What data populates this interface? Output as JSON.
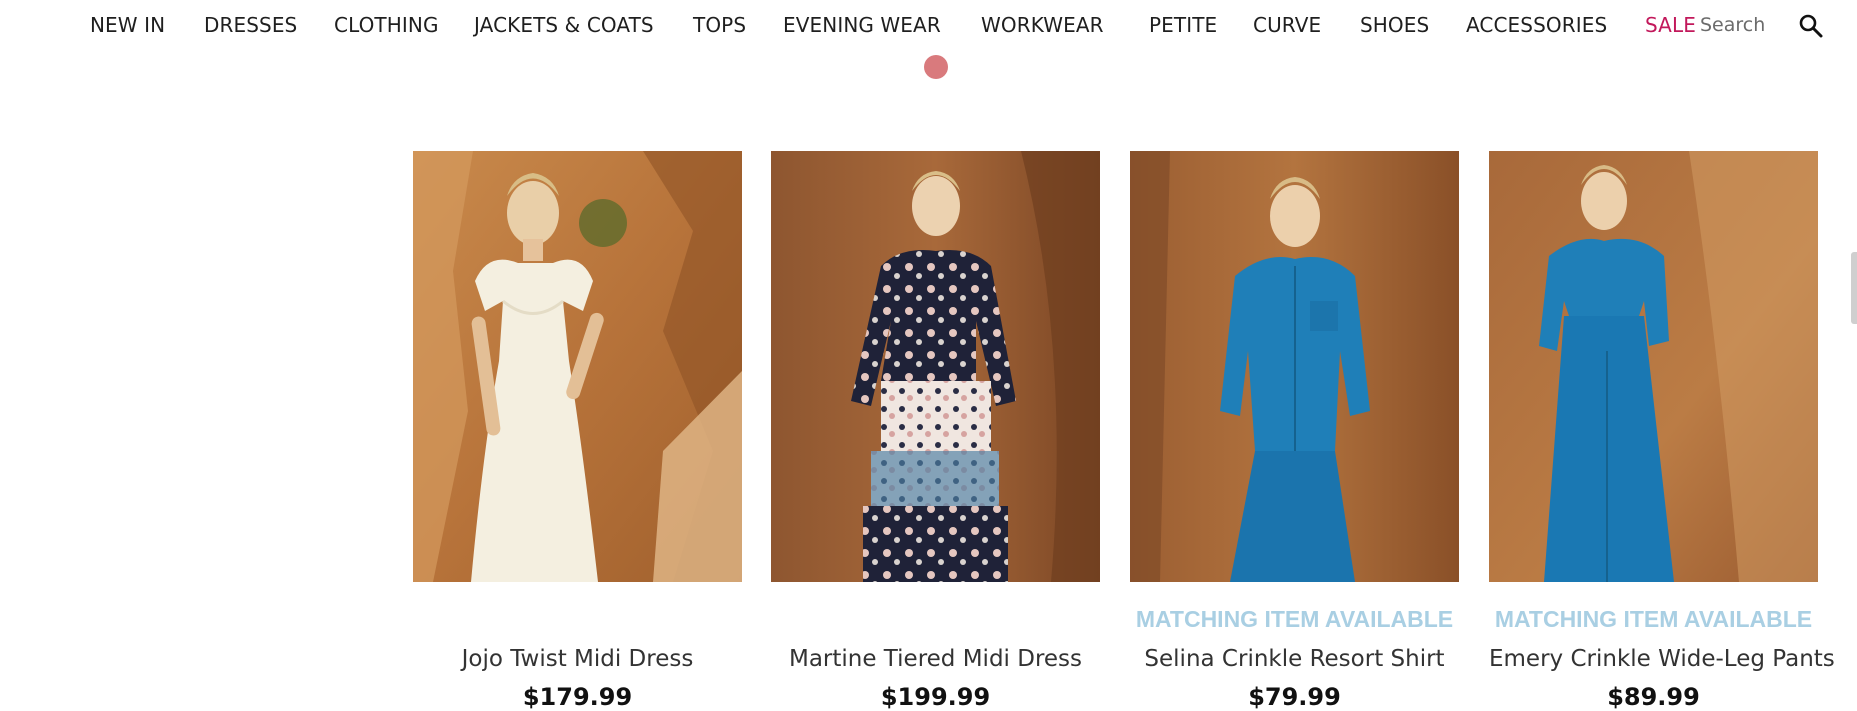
{
  "nav": {
    "items": [
      "NEW IN",
      "DRESSES",
      "CLOTHING",
      "JACKETS & COATS",
      "TOPS",
      "EVENING WEAR",
      "WORKWEAR",
      "PETITE",
      "CURVE",
      "SHOES",
      "ACCESSORIES"
    ],
    "sale": "SALE",
    "search_placeholder": "Search"
  },
  "products": [
    {
      "name": "Jojo Twist Midi Dress",
      "badge": "",
      "price": "$179.99"
    },
    {
      "name": "Martine Tiered Midi Dress",
      "badge": "",
      "price": "$199.99"
    },
    {
      "name": "Selina Crinkle Resort Shirt",
      "badge": "MATCHING ITEM AVAILABLE",
      "price": "$79.99"
    },
    {
      "name": "Emery Crinkle Wide-Leg Pants",
      "badge": "MATCHING ITEM AVAILABLE",
      "price": "$89.99"
    }
  ],
  "colors": {
    "accent_sale": "#c2185b",
    "matching_badge": "#a9cfe3",
    "carousel_dot": "#d97a7d"
  },
  "icons": [
    "search-icon",
    "carousel-dot"
  ]
}
